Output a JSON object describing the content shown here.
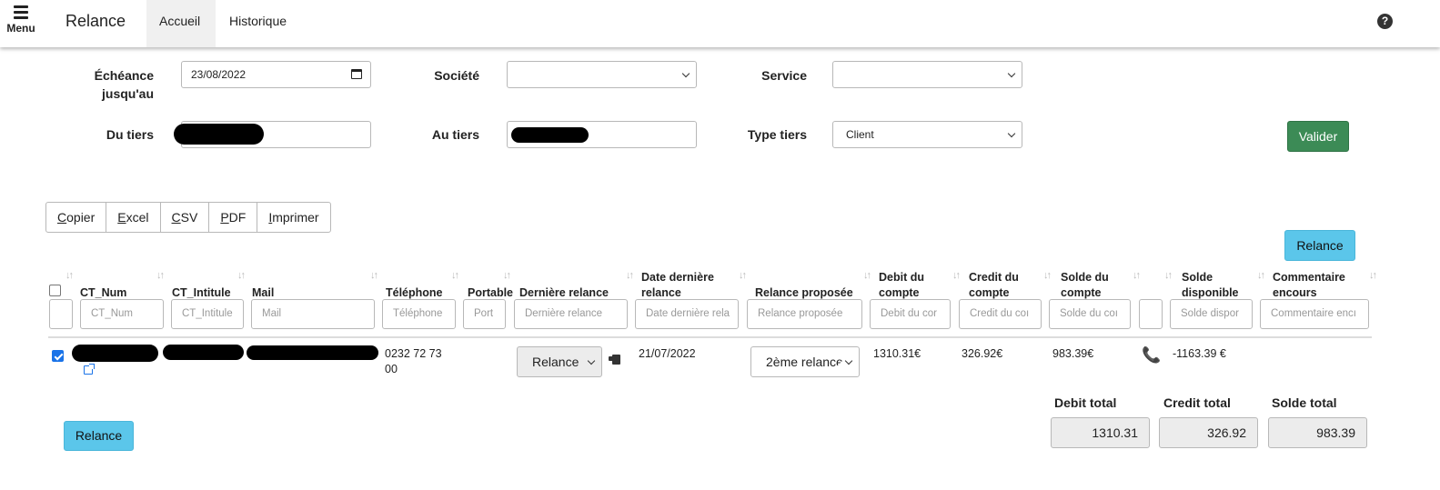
{
  "nav": {
    "menu_label": "Menu",
    "brand": "Relance",
    "tabs": [
      {
        "label": "Accueil",
        "active": true
      },
      {
        "label": "Historique",
        "active": false
      }
    ],
    "help_icon": "question-circle-icon",
    "help_glyph": "?"
  },
  "filters": {
    "echeance_label": "Échéance jusqu'au",
    "echeance_value": "23/08/2022",
    "societe_label": "Société",
    "societe_value": "",
    "service_label": "Service",
    "service_value": "",
    "du_tiers_label": "Du tiers",
    "du_tiers_value": "",
    "au_tiers_label": "Au tiers",
    "au_tiers_value": "",
    "type_tiers_label": "Type tiers",
    "type_tiers_value": "Client",
    "valider_label": "Valider"
  },
  "export_buttons": [
    {
      "accel": "C",
      "rest": "opier"
    },
    {
      "accel": "E",
      "rest": "xcel"
    },
    {
      "accel": "C",
      "rest": "SV"
    },
    {
      "accel": "P",
      "rest": "DF"
    },
    {
      "accel": "I",
      "rest": "mprimer"
    }
  ],
  "relance_button_label": "Relance",
  "table": {
    "columns": [
      {
        "key": "ct_num",
        "header": "CT_Num",
        "filter_placeholder": "CT_Num"
      },
      {
        "key": "ct_intitule",
        "header": "CT_Intitule",
        "filter_placeholder": "CT_Intitule"
      },
      {
        "key": "mail",
        "header": "Mail",
        "filter_placeholder": "Mail"
      },
      {
        "key": "telephone",
        "header": "Téléphone",
        "filter_placeholder": "Téléphone"
      },
      {
        "key": "portable",
        "header": "Portable",
        "filter_placeholder": "Port"
      },
      {
        "key": "derniere_relance",
        "header": "Dernière relance",
        "filter_placeholder": "Dernière relance"
      },
      {
        "key": "date_derniere_relance",
        "header_line1": "Date dernière",
        "header_line2": "relance",
        "filter_placeholder": "Date dernière rela"
      },
      {
        "key": "relance_proposee",
        "header": "Relance proposée",
        "filter_placeholder": "Relance proposée"
      },
      {
        "key": "debit",
        "header_line1": "Debit du",
        "header_line2": "compte",
        "filter_placeholder": "Debit du cor"
      },
      {
        "key": "credit",
        "header_line1": "Credit du",
        "header_line2": "compte",
        "filter_placeholder": "Credit du coı"
      },
      {
        "key": "solde",
        "header_line1": "Solde du",
        "header_line2": "compte",
        "filter_placeholder": "Solde du coı"
      },
      {
        "key": "phone",
        "header": "",
        "filter_placeholder": ""
      },
      {
        "key": "solde_disponible",
        "header_line1": "Solde",
        "header_line2": "disponible",
        "filter_placeholder": "Solde dispor"
      },
      {
        "key": "commentaire",
        "header_line1": "Commentaire",
        "header_line2": "encours",
        "filter_placeholder": "Commentaire encı"
      }
    ],
    "sort_glyph": "↓↑",
    "rows": [
      {
        "checked": true,
        "telephone_line1": "0232 72 73",
        "telephone_line2": "00",
        "derniere_relance": "Relance",
        "date_derniere_relance": "21/07/2022",
        "relance_proposee": "2ème relance",
        "debit": "1310.31€",
        "credit": "326.92€",
        "solde": "983.39€",
        "phone_glyph": "📞",
        "solde_disponible": "-1163.39 €"
      }
    ]
  },
  "totals": {
    "debit_label": "Debit total",
    "debit_value": "1310.31",
    "credit_label": "Credit total",
    "credit_value": "326.92",
    "solde_label": "Solde total",
    "solde_value": "983.39"
  },
  "colors": {
    "success": "#3c8b56",
    "info": "#5bc6ea",
    "checkbox": "#1a73e8"
  }
}
